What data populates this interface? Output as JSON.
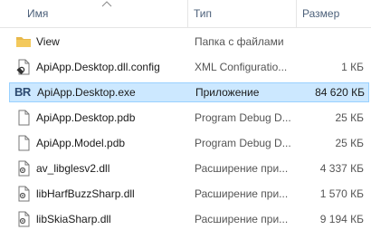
{
  "header": {
    "name_label": "Имя",
    "type_label": "Тип",
    "size_label": "Размер"
  },
  "files": [
    {
      "name": "View",
      "type": "Папка с файлами",
      "size": "",
      "icon": "folder-icon"
    },
    {
      "name": "ApiApp.Desktop.dll.config",
      "type": "XML Configuratio...",
      "size": "1 КБ",
      "icon": "config-file-icon"
    },
    {
      "name": "ApiApp.Desktop.exe",
      "type": "Приложение",
      "size": "84 620 КБ",
      "icon": "app-br-icon",
      "selected": true
    },
    {
      "name": "ApiApp.Desktop.pdb",
      "type": "Program Debug D...",
      "size": "25 КБ",
      "icon": "document-icon"
    },
    {
      "name": "ApiApp.Model.pdb",
      "type": "Program Debug D...",
      "size": "25 КБ",
      "icon": "document-icon"
    },
    {
      "name": "av_libglesv2.dll",
      "type": "Расширение при...",
      "size": "4 337 КБ",
      "icon": "dll-icon"
    },
    {
      "name": "libHarfBuzzSharp.dll",
      "type": "Расширение при...",
      "size": "1 570 КБ",
      "icon": "dll-icon"
    },
    {
      "name": "libSkiaSharp.dll",
      "type": "Расширение при...",
      "size": "9 194 КБ",
      "icon": "dll-icon"
    }
  ],
  "icon_glyphs": {
    "app_badge": "BR"
  },
  "colors": {
    "selection_bg": "#cce8ff",
    "selection_border": "#99d1ff",
    "header_text": "#4c607a",
    "folder": "#e8b84a"
  }
}
